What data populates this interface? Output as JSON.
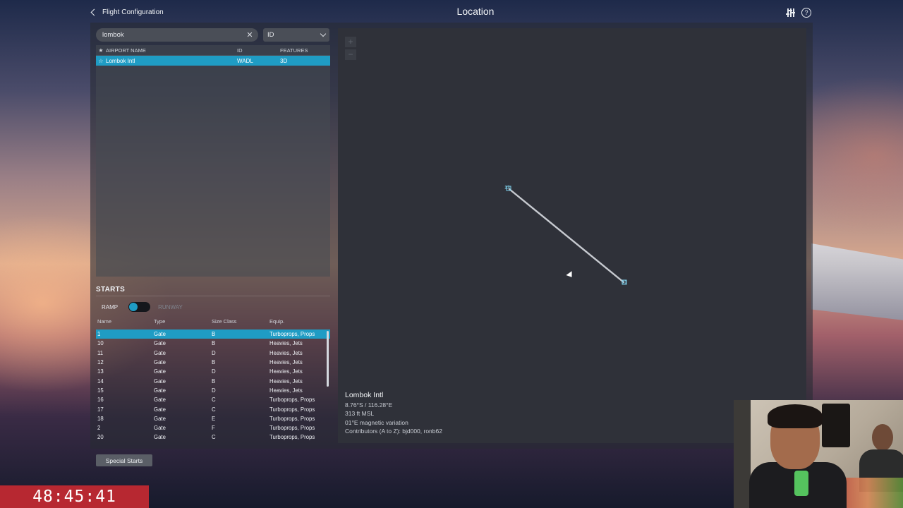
{
  "header": {
    "back_label": "Flight Configuration",
    "title": "Location"
  },
  "search": {
    "value": "lombok",
    "filter_selected": "ID"
  },
  "airport_table": {
    "columns": [
      "AIRPORT NAME",
      "ID",
      "FEATURES"
    ],
    "rows": [
      {
        "favorite": false,
        "name": "Lombok Intl",
        "id": "WADL",
        "features": "3D",
        "selected": true
      }
    ]
  },
  "starts": {
    "title": "STARTS",
    "toggle_left": "RAMP",
    "toggle_right": "RUNWAY",
    "columns": [
      "Name",
      "Type",
      "Size Class",
      "Equip."
    ],
    "rows": [
      {
        "name": "1",
        "type": "Gate",
        "size": "B",
        "equip": "Turboprops, Props"
      },
      {
        "name": "10",
        "type": "Gate",
        "size": "B",
        "equip": "Heavies, Jets"
      },
      {
        "name": "11",
        "type": "Gate",
        "size": "D",
        "equip": "Heavies, Jets"
      },
      {
        "name": "12",
        "type": "Gate",
        "size": "B",
        "equip": "Heavies, Jets"
      },
      {
        "name": "13",
        "type": "Gate",
        "size": "D",
        "equip": "Heavies, Jets"
      },
      {
        "name": "14",
        "type": "Gate",
        "size": "B",
        "equip": "Heavies, Jets"
      },
      {
        "name": "15",
        "type": "Gate",
        "size": "D",
        "equip": "Heavies, Jets"
      },
      {
        "name": "16",
        "type": "Gate",
        "size": "C",
        "equip": "Turboprops, Props"
      },
      {
        "name": "17",
        "type": "Gate",
        "size": "C",
        "equip": "Turboprops, Props"
      },
      {
        "name": "18",
        "type": "Gate",
        "size": "E",
        "equip": "Turboprops, Props"
      },
      {
        "name": "2",
        "type": "Gate",
        "size": "F",
        "equip": "Turboprops, Props"
      },
      {
        "name": "20",
        "type": "Gate",
        "size": "C",
        "equip": "Turboprops, Props"
      }
    ],
    "special_button": "Special Starts"
  },
  "map": {
    "zoom_in": "+",
    "zoom_out": "−",
    "runway_end_a": "13",
    "runway_end_b": "31",
    "info": {
      "name": "Lombok Intl",
      "coords": "8.76°S / 116.28°E",
      "elevation": "313 ft MSL",
      "magvar": "01°E magnetic variation",
      "contributors": "Contributors (A to Z): bjd000,  ronb62"
    }
  },
  "timer": "48:45:41",
  "colors": {
    "accent": "#1f9cc4",
    "panel": "#2f3139",
    "timer_bg": "#b72831"
  },
  "icons": [
    "chevron-left-icon",
    "sliders-icon",
    "help-icon",
    "close-icon",
    "chevron-down-icon",
    "star-icon"
  ]
}
